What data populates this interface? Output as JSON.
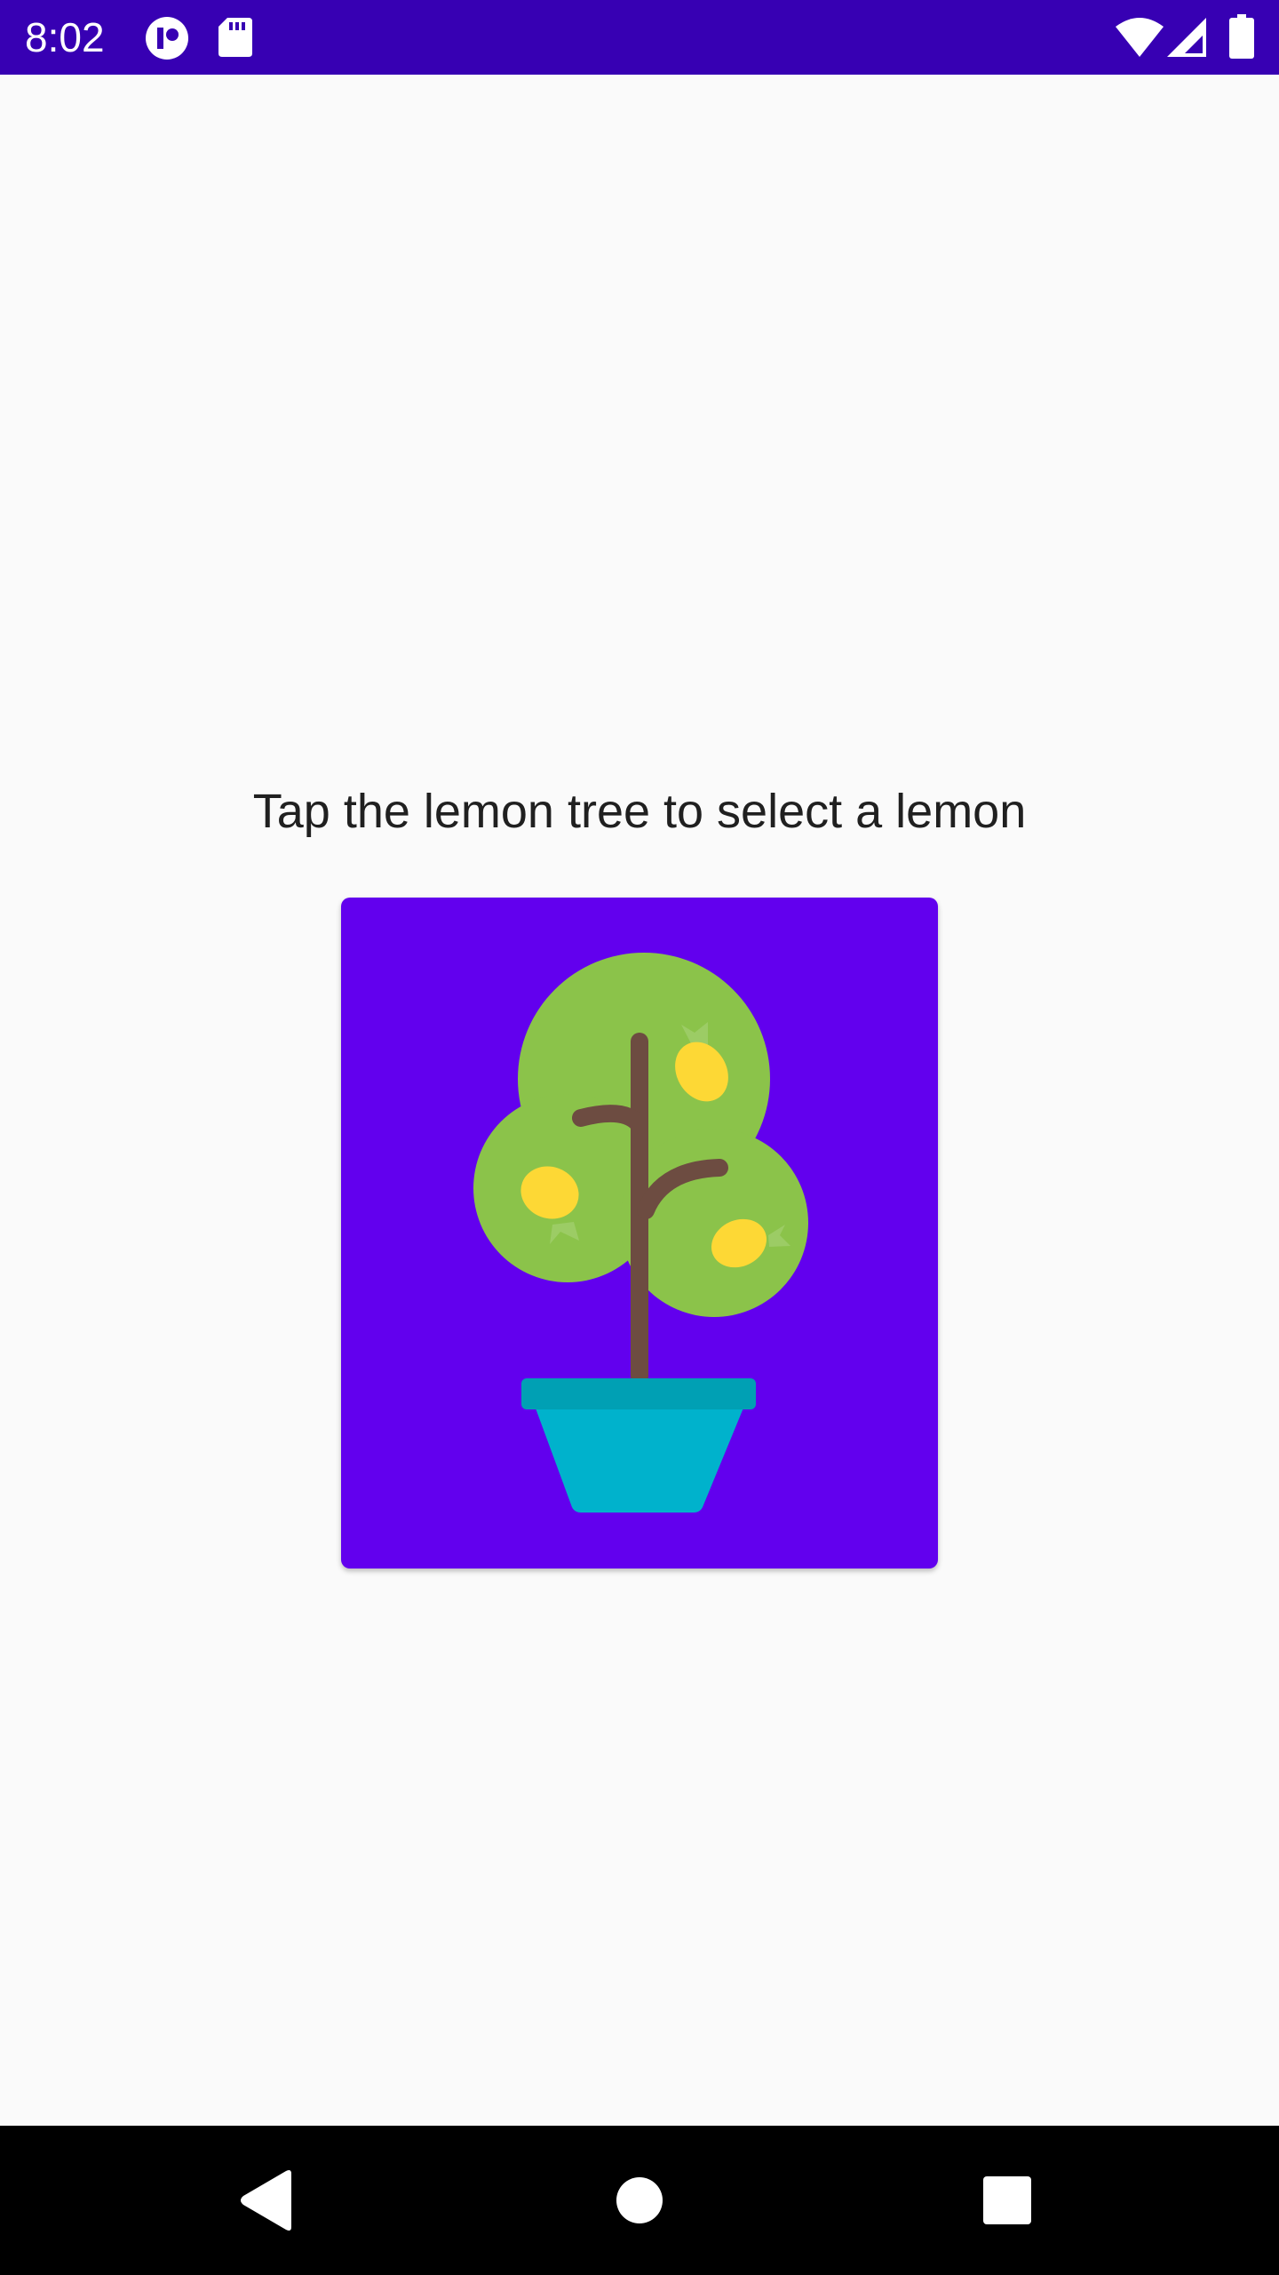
{
  "status_bar": {
    "time": "8:02",
    "background_color": "#3700b3",
    "left_icons": [
      "notification-app-icon",
      "sd-card-icon"
    ],
    "right_icons": [
      "wifi-icon",
      "cell-signal-icon",
      "battery-icon"
    ]
  },
  "main": {
    "instruction": "Tap the lemon tree to select a lemon",
    "image_button": {
      "background_color": "#6200ee",
      "image": "lemon-tree-icon"
    }
  },
  "nav_bar": {
    "buttons": [
      "back-icon",
      "home-icon",
      "recents-icon"
    ]
  }
}
